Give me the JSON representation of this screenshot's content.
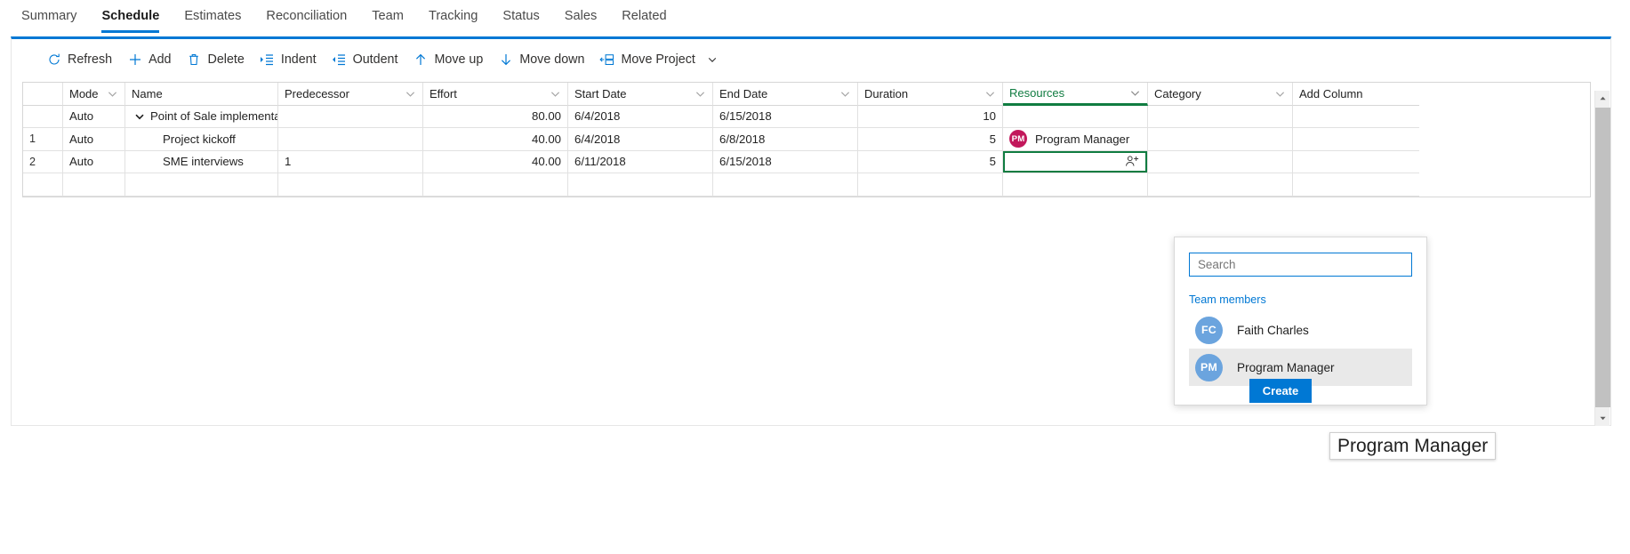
{
  "tabs": [
    {
      "label": "Summary",
      "active": false
    },
    {
      "label": "Schedule",
      "active": true
    },
    {
      "label": "Estimates",
      "active": false
    },
    {
      "label": "Reconciliation",
      "active": false
    },
    {
      "label": "Team",
      "active": false
    },
    {
      "label": "Tracking",
      "active": false
    },
    {
      "label": "Status",
      "active": false
    },
    {
      "label": "Sales",
      "active": false
    },
    {
      "label": "Related",
      "active": false
    }
  ],
  "toolbar": {
    "refresh": "Refresh",
    "add": "Add",
    "delete": "Delete",
    "indent": "Indent",
    "outdent": "Outdent",
    "move_up": "Move up",
    "move_down": "Move down",
    "move_project": "Move Project"
  },
  "grid": {
    "columns": {
      "index": "",
      "mode": "Mode",
      "name": "Name",
      "predecessor": "Predecessor",
      "effort": "Effort",
      "start_date": "Start Date",
      "end_date": "End Date",
      "duration": "Duration",
      "resources": "Resources",
      "category": "Category",
      "add_column": "Add Column"
    },
    "rows": [
      {
        "index": "",
        "mode": "Auto",
        "name": "Point of Sale implementati",
        "predecessor": "",
        "effort": "80.00",
        "start_date": "6/4/2018",
        "end_date": "6/15/2018",
        "duration": "10",
        "resource_name": "",
        "resource_initials": "",
        "category": ""
      },
      {
        "index": "1",
        "mode": "Auto",
        "name": "Project kickoff",
        "predecessor": "",
        "effort": "40.00",
        "start_date": "6/4/2018",
        "end_date": "6/8/2018",
        "duration": "5",
        "resource_name": "Program Manager",
        "resource_initials": "PM",
        "category": ""
      },
      {
        "index": "2",
        "mode": "Auto",
        "name": "SME interviews",
        "predecessor": "1",
        "effort": "40.00",
        "start_date": "6/11/2018",
        "end_date": "6/15/2018",
        "duration": "5",
        "resource_name": "",
        "resource_initials": "",
        "category": ""
      }
    ]
  },
  "flyout": {
    "search_placeholder": "Search",
    "search_value": "",
    "team_members_label": "Team members",
    "members": [
      {
        "initials": "FC",
        "name": "Faith Charles"
      },
      {
        "initials": "PM",
        "name": "Program Manager"
      }
    ],
    "create_label": "Create"
  },
  "tooltip": {
    "text": "Program Manager"
  },
  "colors": {
    "accent_blue": "#0078d4",
    "selected_green": "#107c41",
    "avatar_crimson": "#c2185b",
    "avatar_blue": "#6ba4de"
  }
}
